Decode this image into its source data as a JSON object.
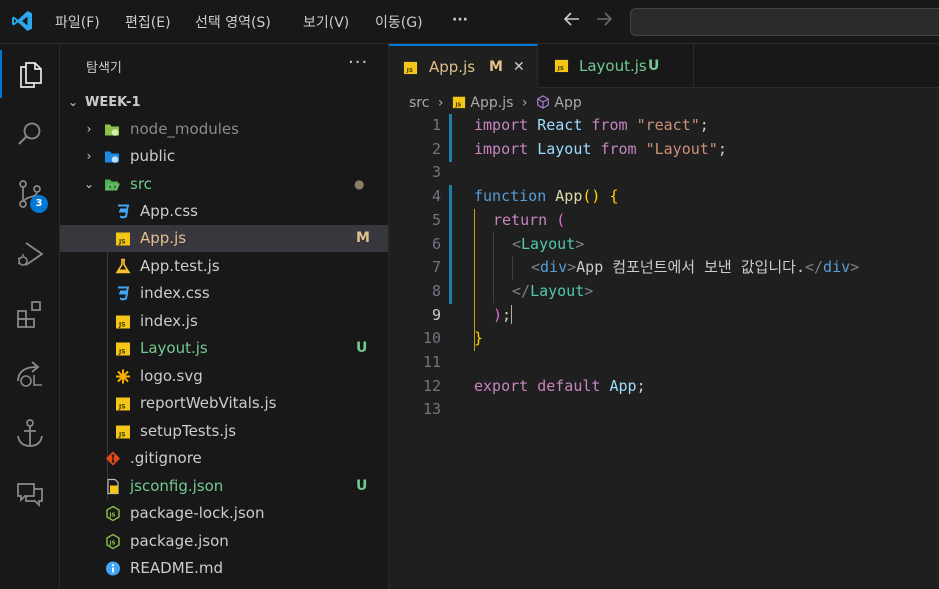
{
  "titlebar": {
    "menus": [
      "파일(F)",
      "편집(E)",
      "선택 영역(S)",
      "보기(V)",
      "이동(G)"
    ],
    "more": "···",
    "back_icon": "arrow-left-icon",
    "forward_icon": "arrow-right-icon"
  },
  "activity": {
    "items": [
      "explorer",
      "search",
      "source-control",
      "run-debug",
      "extensions",
      "remote",
      "anchor",
      "comments"
    ],
    "source_control_badge": "3"
  },
  "sidebar": {
    "title": "탐색기",
    "more": "···",
    "root": "WEEK-1",
    "items": [
      {
        "label": "node_modules",
        "status": "",
        "color": "#8b8b8b"
      },
      {
        "label": "public",
        "status": "",
        "color": "#cccccc"
      },
      {
        "label": "src",
        "status": "●",
        "color": "#73c991"
      },
      {
        "label": "App.css",
        "status": "",
        "color": "#cccccc"
      },
      {
        "label": "App.js",
        "status": "M",
        "color": "#e2c08d"
      },
      {
        "label": "App.test.js",
        "status": "",
        "color": "#cccccc"
      },
      {
        "label": "index.css",
        "status": "",
        "color": "#cccccc"
      },
      {
        "label": "index.js",
        "status": "",
        "color": "#cccccc"
      },
      {
        "label": "Layout.js",
        "status": "U",
        "color": "#73c991"
      },
      {
        "label": "logo.svg",
        "status": "",
        "color": "#cccccc"
      },
      {
        "label": "reportWebVitals.js",
        "status": "",
        "color": "#cccccc"
      },
      {
        "label": "setupTests.js",
        "status": "",
        "color": "#cccccc"
      },
      {
        "label": ".gitignore",
        "status": "",
        "color": "#cccccc"
      },
      {
        "label": "jsconfig.json",
        "status": "U",
        "color": "#73c991"
      },
      {
        "label": "package-lock.json",
        "status": "",
        "color": "#cccccc"
      },
      {
        "label": "package.json",
        "status": "",
        "color": "#cccccc"
      },
      {
        "label": "README.md",
        "status": "",
        "color": "#cccccc"
      }
    ]
  },
  "editor": {
    "tabs": [
      {
        "label": "App.js",
        "status": "M",
        "close": "✕"
      },
      {
        "label": "Layout.js",
        "status": "U"
      }
    ],
    "breadcrumb": {
      "folder": "src",
      "file": "App.js",
      "symbol": "App"
    },
    "line_numbers": [
      "1",
      "2",
      "3",
      "4",
      "5",
      "6",
      "7",
      "8",
      "9",
      "10",
      "11",
      "12",
      "13"
    ],
    "code": {
      "l1": [
        "import",
        " React ",
        "from",
        " ",
        "\"react\"",
        ";"
      ],
      "l2": [
        "import",
        " Layout ",
        "from",
        " ",
        "\"Layout\"",
        ";"
      ],
      "l4": [
        "function",
        " ",
        "App",
        "(",
        ")",
        " ",
        "{"
      ],
      "l5": [
        "return",
        " ",
        "("
      ],
      "l6": [
        "<",
        "Layout",
        ">"
      ],
      "l7": [
        "<",
        "div",
        ">",
        "App 컴포넌트에서 보낸 값입니다.",
        "</",
        "div",
        ">"
      ],
      "l8": [
        "</",
        "Layout",
        ">"
      ],
      "l9": [
        ")",
        ";"
      ],
      "l10": [
        "}"
      ],
      "l12": [
        "export",
        " ",
        "default",
        " ",
        "App",
        ";"
      ]
    }
  },
  "colors": {
    "accent": "#0078d4",
    "modified": "#e2c08d",
    "untracked": "#73c991"
  }
}
